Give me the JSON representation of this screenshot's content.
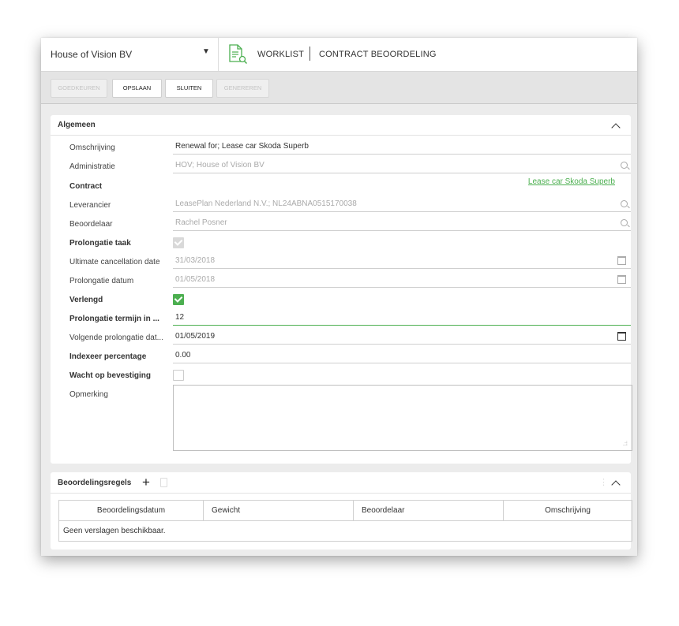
{
  "header": {
    "company": "House of Vision BV",
    "worklist": "WORKLIST",
    "page_title": "CONTRACT BEOORDELING"
  },
  "toolbar": {
    "approve": "GOEDKEUREN",
    "save": "OPSLAAN",
    "close": "SLUITEN",
    "generate": "GENEREREN"
  },
  "general": {
    "title": "Algemeen",
    "fields": {
      "omschrijving": {
        "label": "Omschrijving",
        "value": "Renewal for; Lease car Skoda Superb"
      },
      "administratie": {
        "label": "Administratie",
        "value": "HOV; House of Vision BV"
      },
      "contract": {
        "label": "Contract",
        "link": "Lease car Skoda Superb"
      },
      "leverancier": {
        "label": "Leverancier",
        "value": "LeasePlan Nederland N.V.; NL24ABNA0515170038"
      },
      "beoordelaar": {
        "label": "Beoordelaar",
        "value": "Rachel Posner"
      },
      "prolongatie_taak": {
        "label": "Prolongatie taak",
        "checked": true
      },
      "ultimate_cancellation": {
        "label": "Ultimate cancellation date",
        "value": "31/03/2018"
      },
      "prolongatie_datum": {
        "label": "Prolongatie datum",
        "value": "01/05/2018"
      },
      "verlengd": {
        "label": "Verlengd",
        "checked": true
      },
      "prolongatie_termijn": {
        "label": "Prolongatie termijn in ...",
        "value": "12"
      },
      "volgende_prolongatie": {
        "label": "Volgende prolongatie dat...",
        "value": "01/05/2019"
      },
      "indexeer_percentage": {
        "label": "Indexeer percentage",
        "value": "0.00"
      },
      "wacht_op_bevestiging": {
        "label": "Wacht op bevestiging",
        "checked": false
      },
      "opmerking": {
        "label": "Opmerking",
        "value": ""
      }
    }
  },
  "rules": {
    "title": "Beoordelingsregels",
    "columns": [
      "Beoordelingsdatum",
      "Gewicht",
      "Beoordelaar",
      "Omschrijving"
    ],
    "empty_message": "Geen verslagen beschikbaar."
  },
  "colors": {
    "accent": "#4caf50",
    "toolbar_bg": "#e4e4e4",
    "window_bg": "#ececec"
  }
}
